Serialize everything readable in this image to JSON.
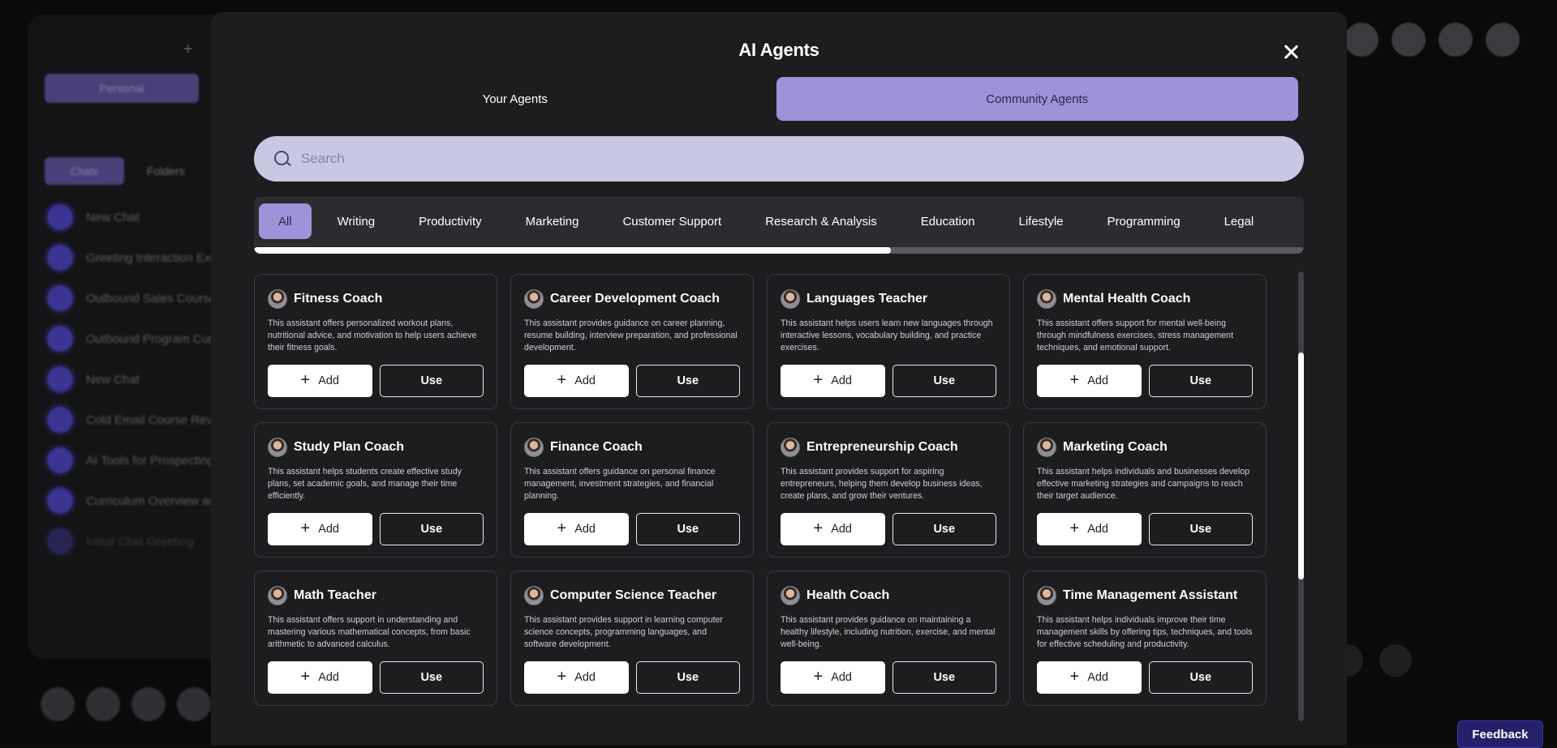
{
  "background": {
    "personal_label": "Personal",
    "tabs": [
      "Chats",
      "Folders"
    ],
    "chats": [
      "New Chat",
      "Greeting Interaction Exchange",
      "Outbound Sales Course",
      "Outbound Program Curriculum",
      "New Chat",
      "Cold Email Course Review",
      "AI Tools for Prospecting",
      "Curriculum Overview and Details",
      "Initial Chat Greeting"
    ]
  },
  "modal": {
    "title": "AI Agents",
    "tabs": [
      {
        "label": "Your Agents",
        "active": false
      },
      {
        "label": "Community Agents",
        "active": true
      }
    ],
    "search_placeholder": "Search",
    "categories": [
      {
        "label": "All",
        "active": true
      },
      {
        "label": "Writing"
      },
      {
        "label": "Productivity"
      },
      {
        "label": "Marketing"
      },
      {
        "label": "Customer Support"
      },
      {
        "label": "Research & Analysis"
      },
      {
        "label": "Education"
      },
      {
        "label": "Lifestyle"
      },
      {
        "label": "Programming"
      },
      {
        "label": "Legal"
      }
    ],
    "add_label": "Add",
    "use_label": "Use",
    "agents": [
      {
        "name": "Fitness Coach",
        "desc": "This assistant offers personalized workout plans, nutritional advice, and motivation to help users achieve their fitness goals."
      },
      {
        "name": "Career Development Coach",
        "desc": "This assistant provides guidance on career planning, resume building, interview preparation, and professional development."
      },
      {
        "name": "Languages Teacher",
        "desc": "This assistant helps users learn new languages through interactive lessons, vocabulary building, and practice exercises."
      },
      {
        "name": "Mental Health Coach",
        "desc": "This assistant offers support for mental well-being through mindfulness exercises, stress management techniques, and emotional support."
      },
      {
        "name": "Study Plan Coach",
        "desc": "This assistant helps students create effective study plans, set academic goals, and manage their time efficiently."
      },
      {
        "name": "Finance Coach",
        "desc": "This assistant offers guidance on personal finance management, investment strategies, and financial planning."
      },
      {
        "name": "Entrepreneurship Coach",
        "desc": "This assistant provides support for aspiring entrepreneurs, helping them develop business ideas, create plans, and grow their ventures."
      },
      {
        "name": "Marketing Coach",
        "desc": "This assistant helps individuals and businesses develop effective marketing strategies and campaigns to reach their target audience."
      },
      {
        "name": "Math Teacher",
        "desc": "This assistant offers support in understanding and mastering various mathematical concepts, from basic arithmetic to advanced calculus."
      },
      {
        "name": "Computer Science Teacher",
        "desc": "This assistant provides support in learning computer science concepts, programming languages, and software development."
      },
      {
        "name": "Health Coach",
        "desc": "This assistant provides guidance on maintaining a healthy lifestyle, including nutrition, exercise, and mental well-being."
      },
      {
        "name": "Time Management Assistant",
        "desc": "This assistant helps individuals improve their time management skills by offering tips, techniques, and tools for effective scheduling and productivity."
      }
    ]
  },
  "feedback_label": "Feedback"
}
